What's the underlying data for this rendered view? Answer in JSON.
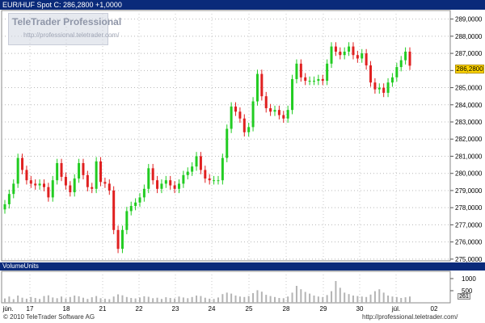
{
  "header": {
    "title": "EUR/HUF Spot C: 286,2800 +1,0000"
  },
  "watermark": {
    "brand": "TeleTrader Professional",
    "url": "http://professional.teletrader.com/"
  },
  "volume_panel": {
    "title": "VolumeUnits",
    "last_value": "261"
  },
  "price_marker": "286,2800",
  "footer": {
    "copyright": "© 2010 TeleTrader Software AG",
    "url": "http://professional.teletrader.com/"
  },
  "colors": {
    "up": "#22cc22",
    "down": "#e02020",
    "doji": "#22cc22",
    "header_bg": "#0a2a7a",
    "volume": "#b4b4b4",
    "price_tag": "#ffd400"
  },
  "chart_data": {
    "type": "line",
    "title": "EUR/HUF Spot",
    "ylim": [
      274.9,
      289.5
    ],
    "yticks": [
      275,
      276,
      277,
      278,
      279,
      280,
      281,
      282,
      283,
      284,
      285,
      286,
      287,
      288,
      289
    ],
    "ytick_labels": [
      "275,0000",
      "276,0000",
      "277,0000",
      "278,0000",
      "279,0000",
      "280,0000",
      "281,0000",
      "282,0000",
      "283,0000",
      "284,0000",
      "285,0000",
      "286,0000",
      "287,0000",
      "288,0000",
      "289,0000"
    ],
    "xlabels": [
      "jún.",
      "17",
      "18",
      "21",
      "22",
      "23",
      "24",
      "25",
      "28",
      "29",
      "30",
      "júl.",
      "02"
    ],
    "last_close": 286.28,
    "change": 1.0,
    "volume": {
      "ylim": [
        0,
        1300
      ],
      "yticks": [
        500,
        1000
      ],
      "ytick_labels": [
        "500",
        "1000"
      ]
    },
    "series": [
      {
        "name": "EUR/HUF",
        "values": [
          278.2,
          278.8,
          279.4,
          280.9,
          280.2,
          279.6,
          279.4,
          279.3,
          279.4,
          279.2,
          278.6,
          279.6,
          280.6,
          279.8,
          279.3,
          278.9,
          279.7,
          280.6,
          279.9,
          279.2,
          279.1,
          280.7,
          279.5,
          279.4,
          279.0,
          276.7,
          275.6,
          276.7,
          277.8,
          278.1,
          278.3,
          278.6,
          279.1,
          280.3,
          279.6,
          279.1,
          279.4,
          279.6,
          279.3,
          279.1,
          279.4,
          279.9,
          280.1,
          280.4,
          281.0,
          280.2,
          279.7,
          279.6,
          279.6,
          279.6,
          280.9,
          282.6,
          283.9,
          283.6,
          283.2,
          282.4,
          282.7,
          284.2,
          285.8,
          284.5,
          283.8,
          283.6,
          283.7,
          283.4,
          283.2,
          283.7,
          285.5,
          286.4,
          285.6,
          285.4,
          285.4,
          285.4,
          285.5,
          285.4,
          286.4,
          287.4,
          287.1,
          286.9,
          287.1,
          287.4,
          286.9,
          286.7,
          287.0,
          286.3,
          285.3,
          284.9,
          285.0,
          284.7,
          285.3,
          285.6,
          286.2,
          286.6,
          287.1,
          286.28
        ],
        "volume": [
          180,
          260,
          150,
          300,
          210,
          170,
          240,
          200,
          160,
          280,
          310,
          220,
          190,
          260,
          180,
          240,
          300,
          270,
          210,
          160,
          230,
          280,
          190,
          170,
          150,
          260,
          350,
          310,
          240,
          200,
          180,
          220,
          270,
          250,
          190,
          210,
          160,
          230,
          200,
          180,
          260,
          220,
          190,
          240,
          300,
          280,
          210,
          170,
          160,
          220,
          360,
          420,
          380,
          300,
          260,
          240,
          280,
          400,
          520,
          460,
          330,
          280,
          240,
          200,
          190,
          260,
          420,
          700,
          560,
          450,
          380,
          300,
          260,
          240,
          320,
          480,
          900,
          620,
          420,
          360,
          300,
          280,
          260,
          240,
          340,
          480,
          560,
          420,
          300,
          260,
          240,
          200,
          230,
          261
        ]
      }
    ]
  }
}
